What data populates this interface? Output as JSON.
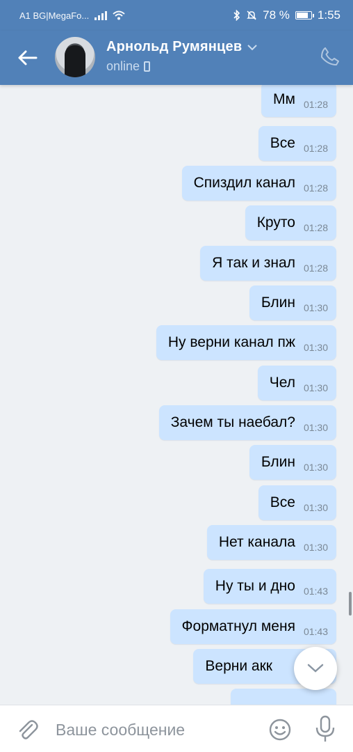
{
  "status_bar": {
    "carrier": "A1 BG|MegaFo...",
    "battery": "78 %",
    "time": "1:55",
    "battery_level": 0.78,
    "icons": [
      "signal-icon",
      "wifi-icon",
      "bluetooth-icon",
      "mute-icon",
      "battery-icon"
    ]
  },
  "header": {
    "contact_name": "Арнольд Румянцев",
    "status": "online",
    "icons": [
      "back-arrow-icon",
      "chevron-down-icon",
      "mobile-device-icon",
      "phone-call-icon"
    ],
    "accent_color": "#5181b8"
  },
  "messages": [
    {
      "text": "Мм",
      "time": "01:28"
    },
    {
      "text": "Все",
      "time": "01:28"
    },
    {
      "text": "Спиздил канал",
      "time": "01:28"
    },
    {
      "text": "Круто",
      "time": "01:28"
    },
    {
      "text": "Я так и знал",
      "time": "01:28"
    },
    {
      "text": "Блин",
      "time": "01:30"
    },
    {
      "text": "Ну верни канал пж",
      "time": "01:30"
    },
    {
      "text": "Чел",
      "time": "01:30"
    },
    {
      "text": "Зачем ты наебал?",
      "time": "01:30"
    },
    {
      "text": "Блин",
      "time": "01:30"
    },
    {
      "text": "Все",
      "time": "01:30"
    },
    {
      "text": "Нет канала",
      "time": "01:30"
    },
    {
      "text": "Ну ты и дно",
      "time": "01:43"
    },
    {
      "text": "Форматнул меня",
      "time": "01:43"
    },
    {
      "text": "Верни акк",
      "time": ""
    }
  ],
  "composer": {
    "placeholder": "Ваше сообщение",
    "value": "",
    "icons": [
      "paperclip-icon",
      "emoji-icon",
      "microphone-icon"
    ]
  },
  "bubble_color": "#cce4ff"
}
